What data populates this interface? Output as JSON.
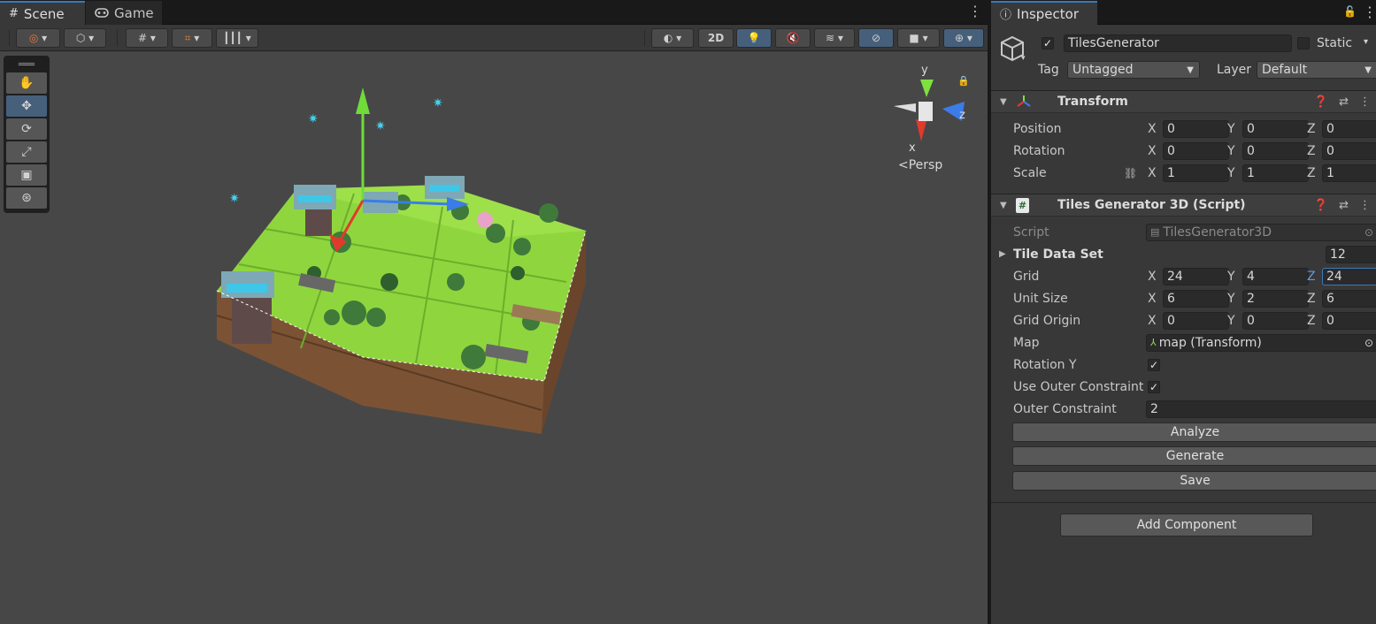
{
  "scene_window": {
    "tabs": [
      {
        "label": "Scene",
        "icon": "grid-icon"
      },
      {
        "label": "Game",
        "icon": "gamepad-icon"
      }
    ],
    "toolbar": {
      "mode_2d": "2D"
    },
    "view": {
      "projection": "Persp",
      "gizmo_axes": {
        "y": "y",
        "z": "z",
        "x": "x"
      }
    }
  },
  "inspector": {
    "tab_label": "Inspector",
    "object": {
      "name": "TilesGenerator",
      "static_label": "Static",
      "tag_label": "Tag",
      "tag_value": "Untagged",
      "layer_label": "Layer",
      "layer_value": "Default"
    },
    "transform": {
      "title": "Transform",
      "rows": [
        {
          "label": "Position",
          "x": "0",
          "y": "0",
          "z": "0"
        },
        {
          "label": "Rotation",
          "x": "0",
          "y": "0",
          "z": "0"
        },
        {
          "label": "Scale",
          "x": "1",
          "y": "1",
          "z": "1"
        }
      ]
    },
    "script_component": {
      "title": "Tiles Generator 3D (Script)",
      "script_label": "Script",
      "script_value": "TilesGenerator3D",
      "tile_data_set_label": "Tile Data Set",
      "tile_data_set_value": "12",
      "vec_rows": [
        {
          "label": "Grid",
          "x": "24",
          "y": "4",
          "z": "24"
        },
        {
          "label": "Unit Size",
          "x": "6",
          "y": "2",
          "z": "6"
        },
        {
          "label": "Grid Origin",
          "x": "0",
          "y": "0",
          "z": "0"
        }
      ],
      "map_label": "Map",
      "map_value": "map (Transform)",
      "rotation_y_label": "Rotation Y",
      "use_outer_label": "Use Outer Constraint",
      "outer_constraint_label": "Outer Constraint",
      "outer_constraint_value": "2",
      "buttons": [
        "Analyze",
        "Generate",
        "Save"
      ]
    },
    "add_component": "Add Component",
    "axis_labels": {
      "x": "X",
      "y": "Y",
      "z": "Z"
    }
  },
  "colors": {
    "accent": "#3a79bb",
    "grass": "#8fd63e",
    "dirt": "#7a5236"
  }
}
